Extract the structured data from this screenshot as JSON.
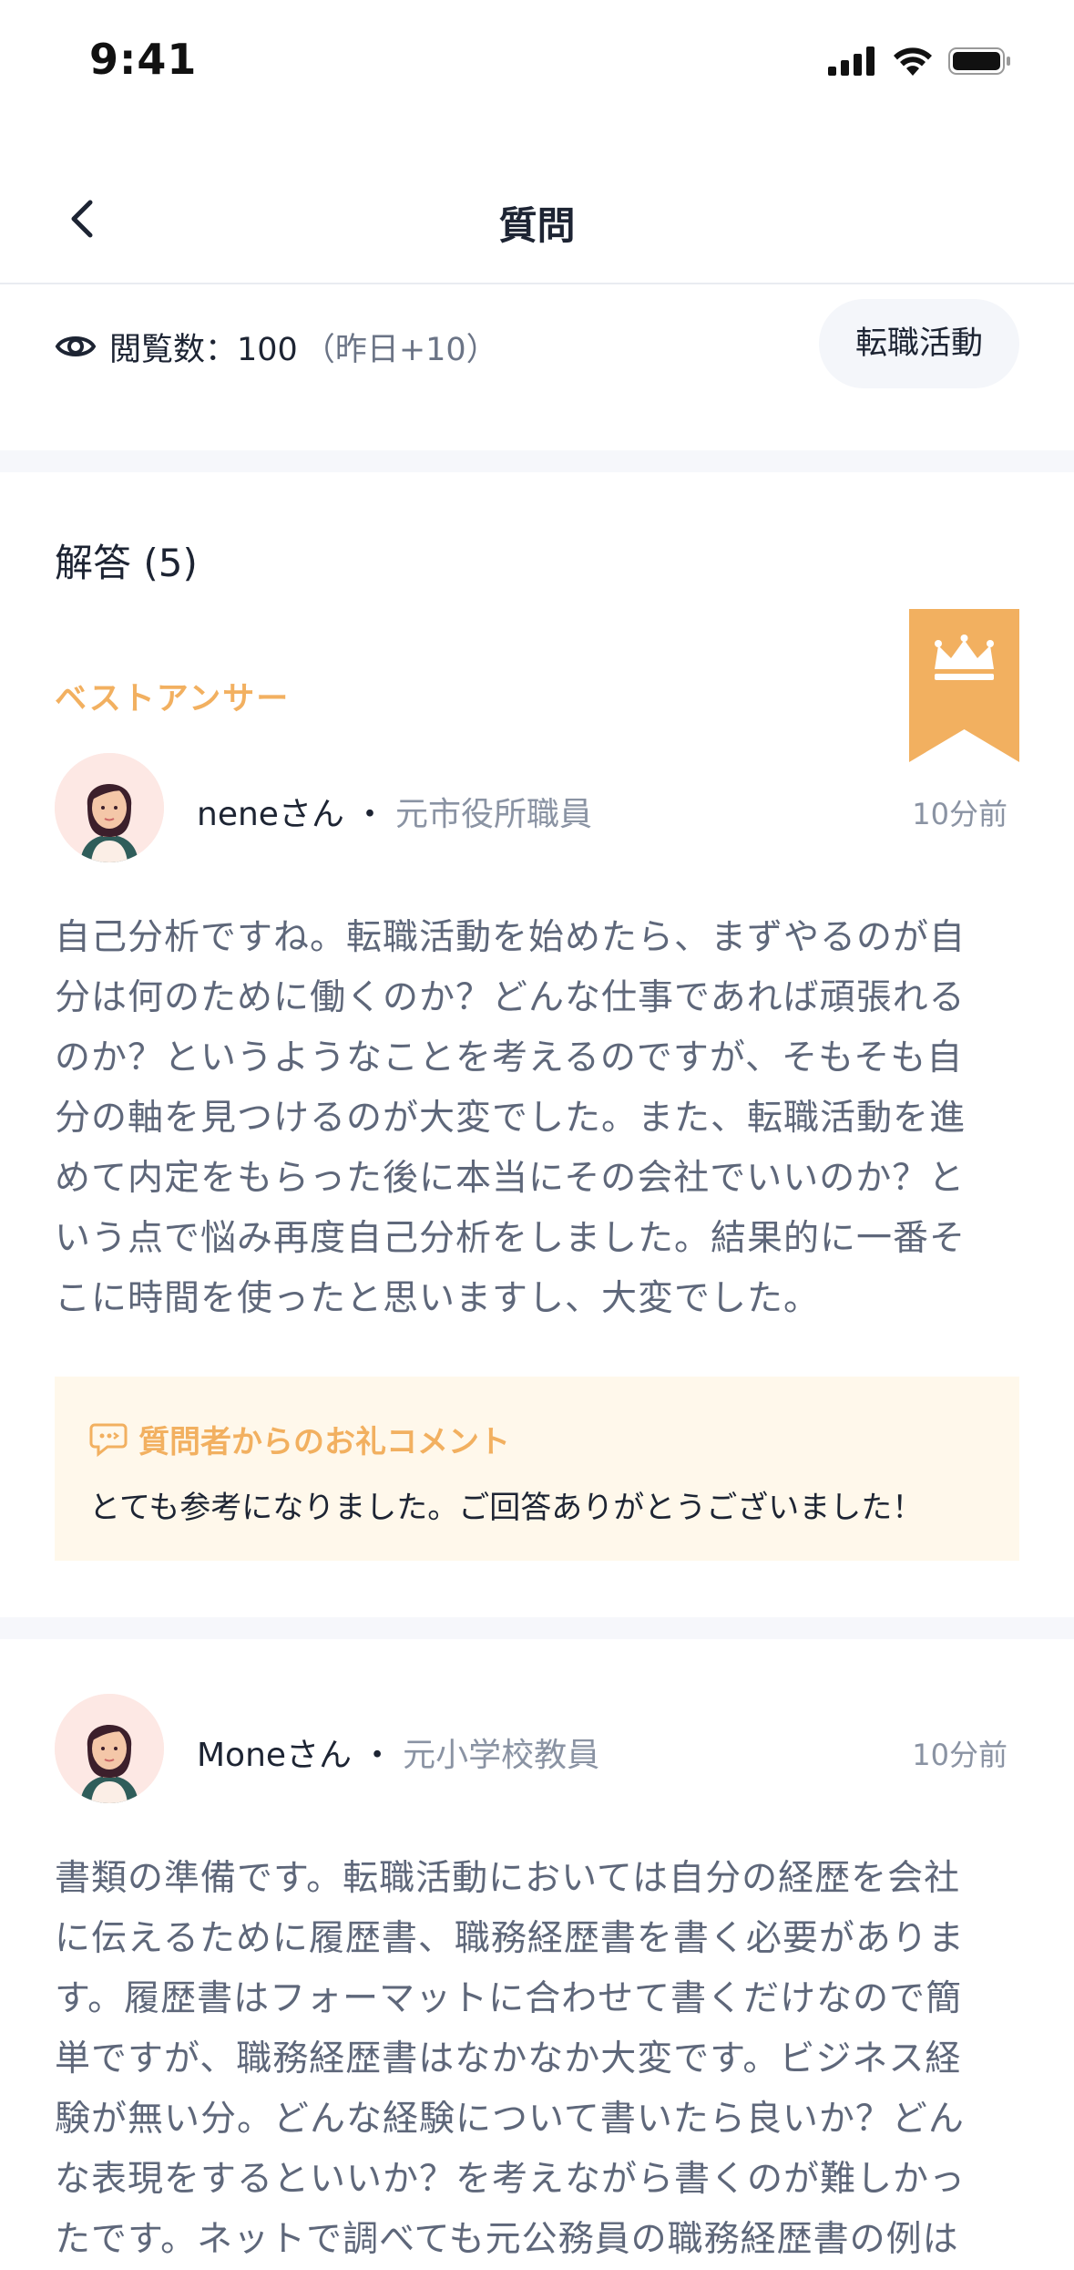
{
  "status": {
    "time": "9:41"
  },
  "nav": {
    "title": "質問"
  },
  "meta": {
    "views_label": "閲覧数：100",
    "views_delta": "（昨日+10）",
    "tag": "転職活動"
  },
  "answers": {
    "heading": "解答 (5)",
    "best_label": "ベストアンサー",
    "items": [
      {
        "name": "neneさん",
        "separator": "・",
        "role": "元市役所職員",
        "time": "10分前",
        "lines": [
          "自己分析ですね。転職活動を始めたら、まずやるのが自",
          "分は何のために働くのか？どんな仕事であれば頑張れる",
          "のか？というようなことを考えるのですが、そもそも自",
          "分の軸を見つけるのが大変でした。また、転職活動を進",
          "めて内定をもらった後に本当にその会社でいいのか？と",
          "いう点で悩み再度自己分析をしました。結果的に一番そ",
          "こに時間を使ったと思いますし、大変でした。"
        ],
        "thanks_title": "質問者からのお礼コメント",
        "thanks_text": "とても参考になりました。ご回答ありがとうございました！"
      },
      {
        "name": "Moneさん",
        "separator": "・",
        "role": "元小学校教員",
        "time": "10分前",
        "lines": [
          "書類の準備です。転職活動においては自分の経歴を会社",
          "に伝えるために履歴書、職務経歴書を書く必要がありま",
          "す。履歴書はフォーマットに合わせて書くだけなので簡",
          "単ですが、職務経歴書はなかなか大変です。ビジネス経",
          "験が無い分。どんな経験について書いたら良いか？どん",
          "な表現をするといいか？を考えながら書くのが難しかっ",
          "たです。ネットで調べても元公務員の職務経歴書の例は"
        ]
      }
    ]
  },
  "colors": {
    "accent": "#f2b060",
    "text": "#1d2433",
    "muted": "#8a93a3",
    "body": "#5e677a"
  }
}
